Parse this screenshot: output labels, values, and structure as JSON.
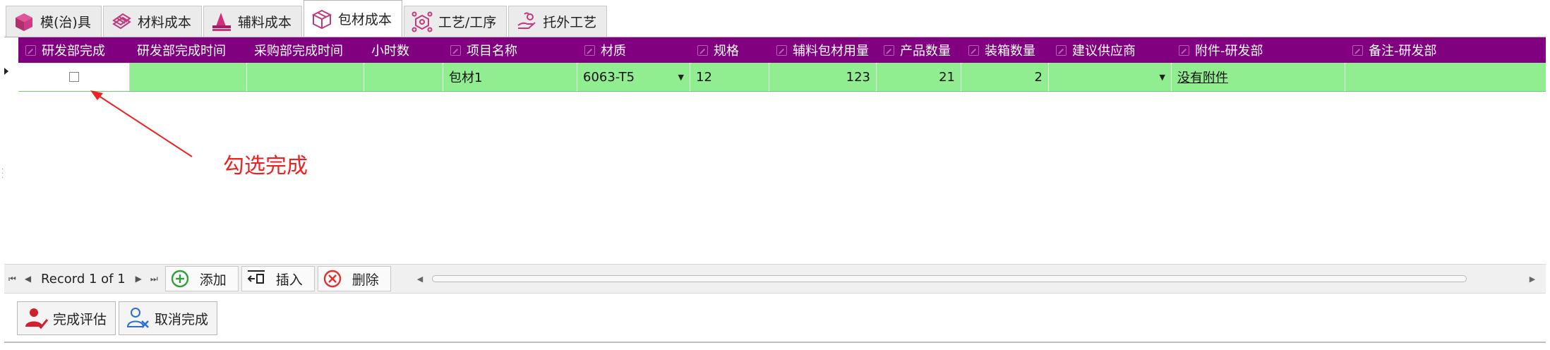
{
  "tabs": [
    {
      "label": "模(治)具",
      "icon": "cube-icon",
      "active": false
    },
    {
      "label": "材料成本",
      "icon": "material-stack-icon",
      "active": false
    },
    {
      "label": "辅料成本",
      "icon": "auxiliary-material-icon",
      "active": false
    },
    {
      "label": "包材成本",
      "icon": "package-box-icon",
      "active": true
    },
    {
      "label": "工艺/工序",
      "icon": "process-flow-icon",
      "active": false
    },
    {
      "label": "托外工艺",
      "icon": "outsource-hand-icon",
      "active": false
    }
  ],
  "grid": {
    "columns": [
      {
        "label": "研发部完成",
        "editable": true
      },
      {
        "label": "研发部完成时间",
        "editable": false
      },
      {
        "label": "采购部完成时间",
        "editable": false
      },
      {
        "label": "小时数",
        "editable": false
      },
      {
        "label": "项目名称",
        "editable": true
      },
      {
        "label": "材质",
        "editable": true
      },
      {
        "label": "规格",
        "editable": true
      },
      {
        "label": "辅料包材用量",
        "editable": true
      },
      {
        "label": "产品数量",
        "editable": true
      },
      {
        "label": "装箱数量",
        "editable": true
      },
      {
        "label": "建议供应商",
        "editable": true
      },
      {
        "label": "附件-研发部",
        "editable": true
      },
      {
        "label": "备注-研发部",
        "editable": true
      }
    ],
    "row": {
      "rd_done": false,
      "rd_done_time": "",
      "purchase_done_time": "",
      "hours": "",
      "item_name": "包材1",
      "material": "6063-T5",
      "spec": "12",
      "usage": "123",
      "product_qty": "21",
      "packing_qty": "2",
      "supplier": "",
      "attachment": "没有附件",
      "remark": ""
    }
  },
  "annotation": {
    "text": "勾选完成",
    "color": "#ee2222"
  },
  "navigator": {
    "record_text": "Record 1 of 1",
    "add_label": "添加",
    "insert_label": "插入",
    "delete_label": "删除"
  },
  "toolbar": {
    "complete_label": "完成评估",
    "cancel_label": "取消完成"
  },
  "colors": {
    "header_bg": "#800080",
    "row_bg": "#90ee90",
    "accent_red": "#ee2222",
    "add_green": "#2e9e3e"
  }
}
